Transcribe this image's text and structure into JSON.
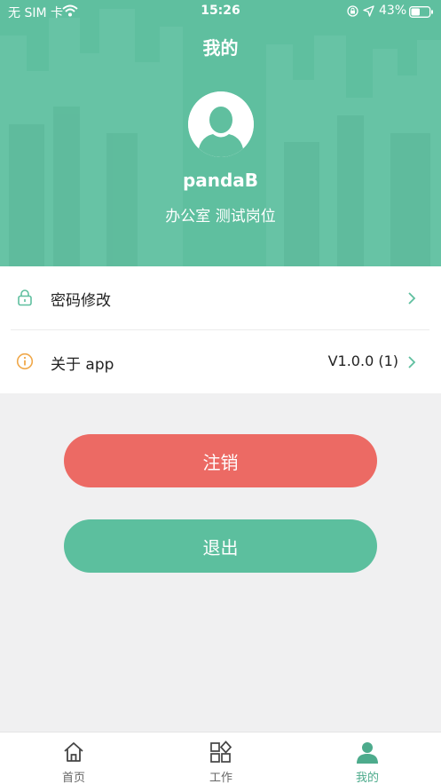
{
  "status_bar": {
    "carrier": "无 SIM 卡",
    "time": "15:26",
    "battery": "43%"
  },
  "header": {
    "title": "我的",
    "user_name": "pandaB",
    "user_dept": "办公室 测试岗位"
  },
  "menu": {
    "items": [
      {
        "label": "密码修改",
        "value": "",
        "icon": "lock-icon"
      },
      {
        "label": "关于 app",
        "value": "V1.0.0 (1)",
        "icon": "info-icon"
      }
    ]
  },
  "buttons": {
    "cancel_account": "注销",
    "logout": "退出"
  },
  "tab_bar": {
    "tabs": [
      {
        "label": "首页",
        "icon": "home-icon"
      },
      {
        "label": "工作",
        "icon": "grid-icon"
      },
      {
        "label": "我的",
        "icon": "person-icon"
      }
    ],
    "active_index": 2
  },
  "colors": {
    "primary": "#5fbf9f",
    "danger": "#ec6a64",
    "info_icon": "#f0a84a"
  }
}
